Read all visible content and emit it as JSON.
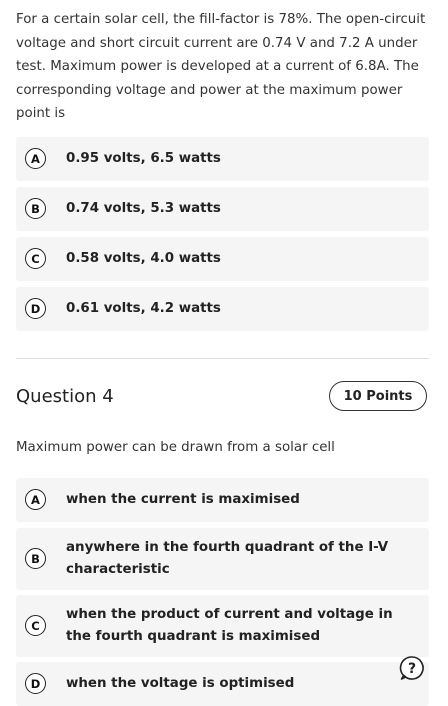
{
  "question3": {
    "text": "For a certain solar cell, the fill-factor is 78%. The open-circuit voltage and short circuit current are 0.74 V and 7.2 A under test. Maximum power is developed at a current of 6.8A. The corresponding voltage and power at the maximum power point is",
    "options": [
      {
        "letter": "A",
        "text": "0.95 volts, 6.5 watts"
      },
      {
        "letter": "B",
        "text": "0.74 volts, 5.3 watts"
      },
      {
        "letter": "C",
        "text": "0.58 volts, 4.0 watts"
      },
      {
        "letter": "D",
        "text": "0.61 volts, 4.2 watts"
      }
    ]
  },
  "question4": {
    "title": "Question 4",
    "points": "10 Points",
    "text": "Maximum power can be drawn from a solar cell",
    "options": [
      {
        "letter": "A",
        "text": "when the current is maximised"
      },
      {
        "letter": "B",
        "text": "anywhere in the fourth quadrant of the I-V characteristic"
      },
      {
        "letter": "C",
        "text": "when the product of current and voltage in the fourth quadrant is maximised"
      },
      {
        "letter": "D",
        "text": "when the voltage is optimised"
      }
    ]
  },
  "help": {
    "icon": "help-icon"
  }
}
